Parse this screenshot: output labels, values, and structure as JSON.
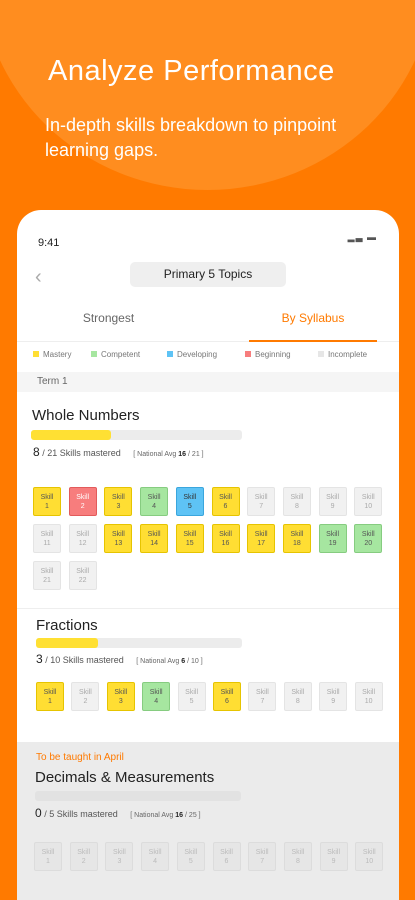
{
  "promo": {
    "headline": "Analyze Performance",
    "subline": "In-depth skills breakdown to pinpoint learning gaps."
  },
  "status_bar": {
    "time": "9:41"
  },
  "header": {
    "topic_select": "Primary 5 Topics"
  },
  "tabs": [
    {
      "label": "Strongest",
      "active": false
    },
    {
      "label": "By Syllabus",
      "active": true
    }
  ],
  "legend": [
    {
      "key": "mastery",
      "label": "Mastery",
      "color": "#ffde33"
    },
    {
      "key": "competent",
      "label": "Competent",
      "color": "#a6e6a0"
    },
    {
      "key": "developing",
      "label": "Developing",
      "color": "#5ec3f5"
    },
    {
      "key": "beginning",
      "label": "Beginning",
      "color": "#f77d7d"
    },
    {
      "key": "incomplete",
      "label": "Incomplete",
      "color": "#e6e6e6"
    }
  ],
  "term_label": "Term 1",
  "sections": [
    {
      "title": "Whole Numbers",
      "upcoming_label": "",
      "mastered": "8",
      "total_text": "/ 21 Skills mastered",
      "national_prefix": "[ National Avg",
      "national_value": "16",
      "national_suffix": "/ 21 ]",
      "progress": 0.38,
      "skills": [
        {
          "label": "Skill",
          "num": "1",
          "status": "mastery"
        },
        {
          "label": "Skill",
          "num": "2",
          "status": "beginning"
        },
        {
          "label": "Skill",
          "num": "3",
          "status": "mastery"
        },
        {
          "label": "Skill",
          "num": "4",
          "status": "competent"
        },
        {
          "label": "Skill",
          "num": "5",
          "status": "developing"
        },
        {
          "label": "Skill",
          "num": "6",
          "status": "mastery"
        },
        {
          "label": "Skill",
          "num": "7",
          "status": "incomplete"
        },
        {
          "label": "Skill",
          "num": "8",
          "status": "incomplete"
        },
        {
          "label": "Skill",
          "num": "9",
          "status": "incomplete"
        },
        {
          "label": "Skill",
          "num": "10",
          "status": "incomplete"
        },
        {
          "label": "Skill",
          "num": "11",
          "status": "incomplete"
        },
        {
          "label": "Skill",
          "num": "12",
          "status": "incomplete"
        },
        {
          "label": "Skill",
          "num": "13",
          "status": "mastery"
        },
        {
          "label": "Skill",
          "num": "14",
          "status": "mastery"
        },
        {
          "label": "Skill",
          "num": "15",
          "status": "mastery"
        },
        {
          "label": "Skill",
          "num": "16",
          "status": "mastery"
        },
        {
          "label": "Skill",
          "num": "17",
          "status": "mastery"
        },
        {
          "label": "Skill",
          "num": "18",
          "status": "mastery"
        },
        {
          "label": "Skill",
          "num": "19",
          "status": "competent"
        },
        {
          "label": "Skill",
          "num": "20",
          "status": "competent"
        },
        {
          "label": "Skill",
          "num": "21",
          "status": "incomplete"
        },
        {
          "label": "Skill",
          "num": "22",
          "status": "incomplete"
        }
      ]
    },
    {
      "title": "Fractions",
      "upcoming_label": "",
      "mastered": "3",
      "total_text": "/ 10 Skills mastered",
      "national_prefix": "[ National Avg",
      "national_value": "6",
      "national_suffix": "/ 10 ]",
      "progress": 0.3,
      "skills": [
        {
          "label": "Skill",
          "num": "1",
          "status": "mastery"
        },
        {
          "label": "Skill",
          "num": "2",
          "status": "incomplete"
        },
        {
          "label": "Skill",
          "num": "3",
          "status": "mastery"
        },
        {
          "label": "Skill",
          "num": "4",
          "status": "competent"
        },
        {
          "label": "Skill",
          "num": "5",
          "status": "incomplete"
        },
        {
          "label": "Skill",
          "num": "6",
          "status": "mastery"
        },
        {
          "label": "Skill",
          "num": "7",
          "status": "incomplete"
        },
        {
          "label": "Skill",
          "num": "8",
          "status": "incomplete"
        },
        {
          "label": "Skill",
          "num": "9",
          "status": "incomplete"
        },
        {
          "label": "Skill",
          "num": "10",
          "status": "incomplete"
        }
      ]
    },
    {
      "title": "Decimals & Measurements",
      "upcoming_label": "To be taught in April",
      "mastered": "0",
      "total_text": "/ 5 Skills mastered",
      "national_prefix": "[ National Avg",
      "national_value": "16",
      "national_suffix": "/ 25 ]",
      "progress": 0,
      "skills": [
        {
          "label": "Skill",
          "num": "1",
          "status": "incomplete"
        },
        {
          "label": "Skill",
          "num": "2",
          "status": "incomplete"
        },
        {
          "label": "Skill",
          "num": "3",
          "status": "incomplete"
        },
        {
          "label": "Skill",
          "num": "4",
          "status": "incomplete"
        },
        {
          "label": "Skill",
          "num": "5",
          "status": "incomplete"
        },
        {
          "label": "Skill",
          "num": "6",
          "status": "incomplete"
        },
        {
          "label": "Skill",
          "num": "7",
          "status": "incomplete"
        },
        {
          "label": "Skill",
          "num": "8",
          "status": "incomplete"
        },
        {
          "label": "Skill",
          "num": "9",
          "status": "incomplete"
        },
        {
          "label": "Skill",
          "num": "10",
          "status": "incomplete"
        }
      ]
    }
  ]
}
